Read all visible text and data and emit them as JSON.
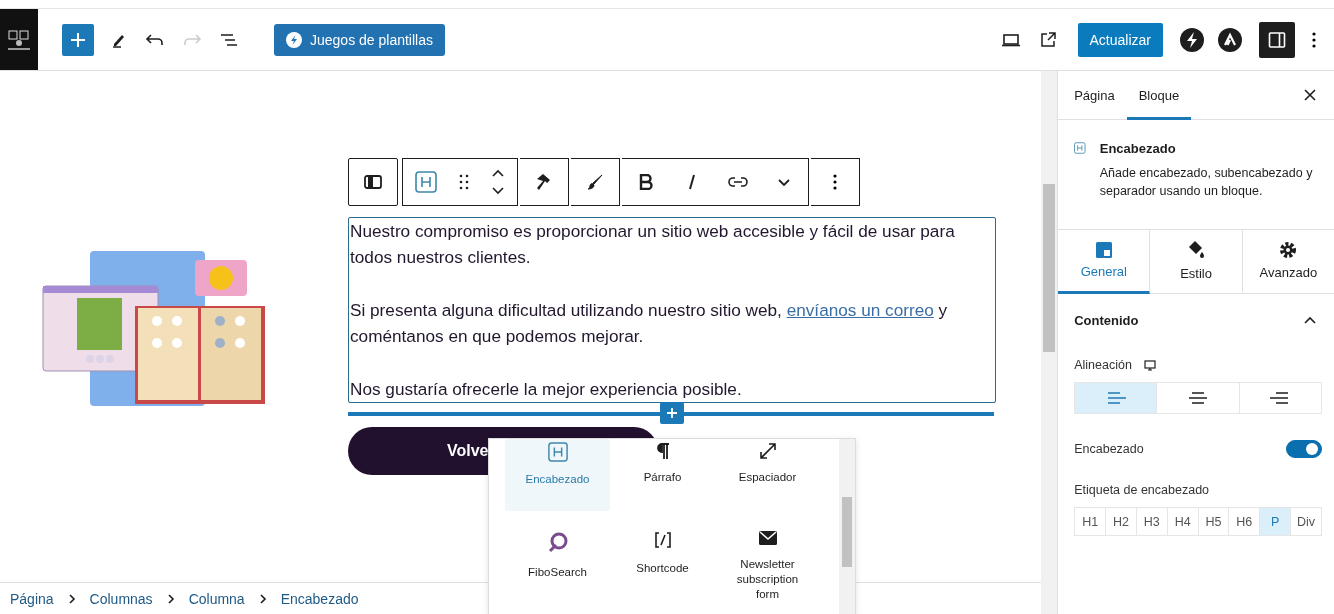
{
  "top_bar": {
    "patterns_button": "Juegos de plantillas",
    "update_button": "Actualizar",
    "settings_toggle": {
      "selected": true
    }
  },
  "content": {
    "paragraphs": [
      {
        "before": "Nuestro compromiso es proporcionar un sitio web accesible y fácil de usar para todos nuestros clientes."
      },
      {
        "before": "Si presenta alguna dificultad utilizando nuestro sitio web, ",
        "link": "envíanos un correo",
        "after": " y coméntanos en que podemos mejorar."
      },
      {
        "before": "Nos gustaría ofrecerle la mejor experiencia posible."
      }
    ],
    "button": "Volve"
  },
  "inserter": {
    "items": [
      {
        "label": "Encabezado",
        "kind": "heading",
        "selected": true
      },
      {
        "label": "Párrafo",
        "kind": "paragraph",
        "selected": false
      },
      {
        "label": "Espaciador",
        "kind": "spacer",
        "selected": false
      },
      {
        "label": "FiboSearch",
        "kind": "fibosearch",
        "selected": false
      },
      {
        "label": "Shortcode",
        "kind": "shortcode",
        "selected": false
      },
      {
        "label": "Newsletter subscription form",
        "kind": "newsletter",
        "selected": false
      }
    ]
  },
  "breadcrumb": [
    "Página",
    "Columnas",
    "Columna",
    "Encabezado"
  ],
  "sidebar": {
    "tabs": [
      {
        "label": "Página",
        "selected": false
      },
      {
        "label": "Bloque",
        "selected": true
      }
    ],
    "block": {
      "title": "Encabezado",
      "description": "Añade encabezado, subencabezado y separador usando un bloque."
    },
    "panel_tabs": [
      {
        "label": "General",
        "kind": "general",
        "selected": true
      },
      {
        "label": "Estilo",
        "kind": "style",
        "selected": false
      },
      {
        "label": "Avanzado",
        "kind": "advanced",
        "selected": false
      }
    ],
    "section": {
      "title": "Contenido",
      "expanded": true
    },
    "alignment": {
      "label": "Alineación",
      "options": [
        {
          "kind": "left",
          "selected": true
        },
        {
          "kind": "center",
          "selected": false
        },
        {
          "kind": "right",
          "selected": false
        }
      ]
    },
    "heading_toggle": {
      "label": "Encabezado",
      "on": true
    },
    "tag": {
      "label": "Etiqueta de encabezado",
      "options": [
        {
          "label": "H1",
          "selected": false
        },
        {
          "label": "H2",
          "selected": false
        },
        {
          "label": "H3",
          "selected": false
        },
        {
          "label": "H4",
          "selected": false
        },
        {
          "label": "H5",
          "selected": false
        },
        {
          "label": "H6",
          "selected": false
        },
        {
          "label": "P",
          "selected": true
        },
        {
          "label": "Div",
          "selected": false
        }
      ]
    }
  }
}
